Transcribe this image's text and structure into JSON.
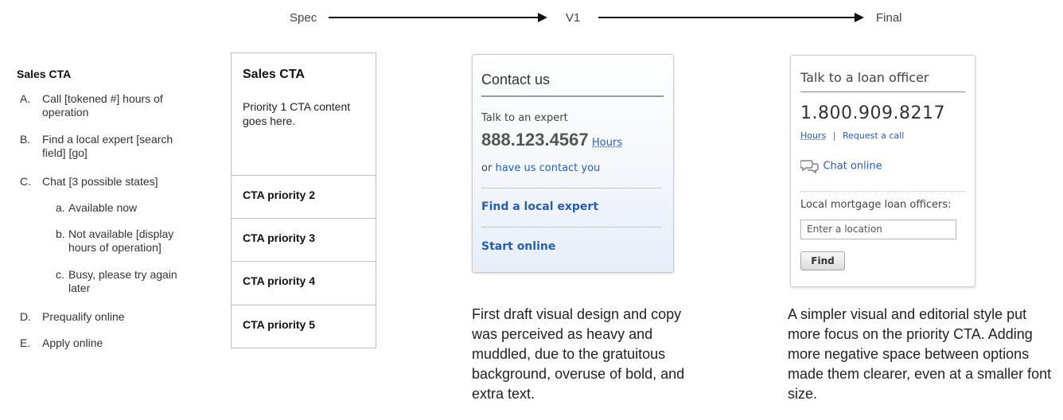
{
  "flow": {
    "spec": "Spec",
    "v1": "V1",
    "final": "Final"
  },
  "spec_list": {
    "title": "Sales CTA",
    "items": [
      {
        "marker": "A.",
        "text": "Call [tokened #] hours of operation"
      },
      {
        "marker": "B.",
        "text": "Find a local expert [search field] [go]"
      },
      {
        "marker": "C.",
        "text": "Chat [3 possible states]"
      },
      {
        "marker": "D.",
        "text": "Prequalify online"
      },
      {
        "marker": "E.",
        "text": "Apply online"
      }
    ],
    "subitems": [
      {
        "marker": "a.",
        "text": "Available now"
      },
      {
        "marker": "b.",
        "text": "Not available [display hours of operation]"
      },
      {
        "marker": "c.",
        "text": "Busy, please try again later"
      }
    ]
  },
  "priority_table": {
    "title": "Sales CTA",
    "body": "Priority 1 CTA content goes here.",
    "rows": [
      "CTA priority 2",
      "CTA priority 3",
      "CTA priority 4",
      "CTA priority 5"
    ]
  },
  "v1_card": {
    "header": "Contact us",
    "talk": "Talk to an expert",
    "phone": "888.123.4567",
    "hours": "Hours",
    "or": "or",
    "contact_link": "have us contact you",
    "find": "Find a local expert",
    "start": "Start online",
    "caption": "First draft visual design and copy was perceived as heavy and muddled, due to the gratuitous background, overuse of bold, and extra text."
  },
  "final_card": {
    "title": "Talk to a loan officer",
    "phone": "1.800.909.8217",
    "hours": "Hours",
    "separator": "|",
    "request": "Request a call",
    "chat": "Chat online",
    "local_label": "Local mortgage loan officers:",
    "input_placeholder": "Enter a location",
    "find_button": "Find",
    "caption": "A simpler visual and editorial style put more focus on the priority CTA. Adding more negative space between options made them clearer, even at a smaller font size."
  },
  "colors": {
    "link": "#2a5db0",
    "arrow": "#111111"
  }
}
